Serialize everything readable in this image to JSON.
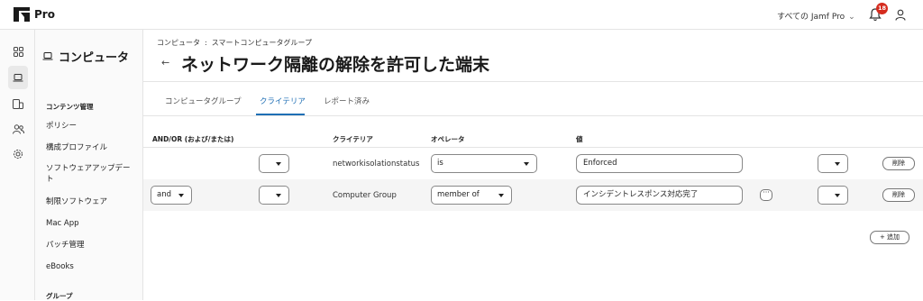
{
  "app": {
    "name": "Pro",
    "environment": "すべての Jamf Pro",
    "notification_count": "18"
  },
  "sidebar": {
    "title": "コンピュータ",
    "section_content": "コンテンツ管理",
    "items": [
      "ポリシー",
      "構成プロファイル",
      "ソフトウェアアップデート",
      "制限ソフトウェア",
      "Mac App",
      "パッチ管理",
      "eBooks"
    ],
    "section_groups": "グループ"
  },
  "breadcrumb": {
    "parent": "コンピュータ",
    "separator": ":",
    "current": "スマートコンピュータグループ"
  },
  "page": {
    "title": "ネットワーク隔離の解除を許可した端末"
  },
  "tabs": [
    {
      "label": "コンピュータグループ",
      "active": false
    },
    {
      "label": "クライテリア",
      "active": true
    },
    {
      "label": "レポート済み",
      "active": false
    }
  ],
  "table": {
    "headers": {
      "andor": "AND/OR (および/または)",
      "criteria": "クライテリア",
      "operator": "オペレータ",
      "value": "値"
    },
    "rows": [
      {
        "andor": "",
        "paren_open": "",
        "criteria": "networkisolationstatus",
        "operator": "is",
        "value": "Enforced",
        "paren_close": "",
        "delete_label": "削除"
      },
      {
        "andor": "and",
        "paren_open": "",
        "criteria": "Computer Group",
        "operator": "member of",
        "value": "インシデントレスポンス対応完了",
        "more": "···",
        "paren_close": "",
        "delete_label": "削除"
      }
    ],
    "add_label": "追加"
  },
  "colors": {
    "accent": "#1f6fb5",
    "badge": "#d52b1e"
  }
}
